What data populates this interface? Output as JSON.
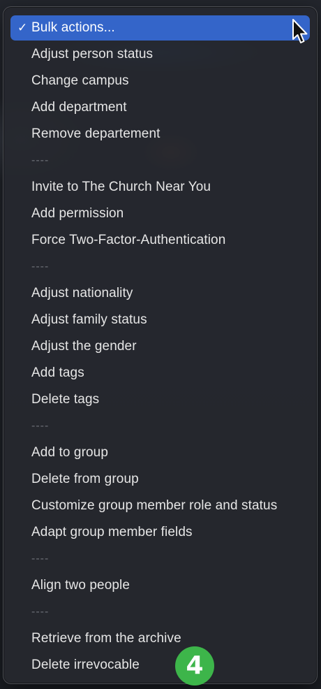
{
  "menu": {
    "selected": {
      "check": "✓",
      "label": "Bulk actions..."
    },
    "items": [
      "Adjust person status",
      "Change campus",
      "Add department",
      "Remove departement",
      "Invite to The Church Near You",
      "Add permission",
      "Force Two-Factor-Authentication",
      "Adjust nationality",
      "Adjust family status",
      "Adjust the gender",
      "Add tags",
      "Delete tags",
      "Add to group",
      "Delete from group",
      "Customize group member role and status",
      "Adapt group member fields",
      "Align two people",
      "Retrieve from the archive",
      "Delete irrevocable"
    ],
    "separator": "----"
  },
  "badge": {
    "label": "4",
    "color": "#3db54a"
  },
  "colors": {
    "selected_bg": "#3465c9",
    "menu_bg": "#26282e",
    "text": "#e6e6e6"
  },
  "icons": {
    "check": "checkmark-icon",
    "cursor": "mouse-pointer-icon"
  }
}
